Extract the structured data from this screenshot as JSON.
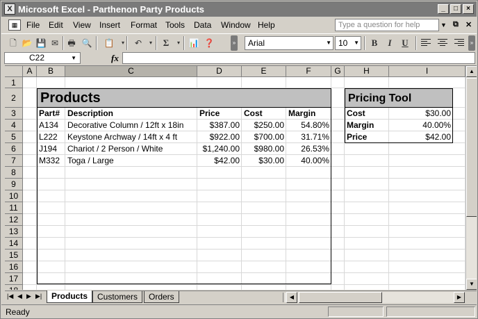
{
  "window": {
    "title": "Microsoft Excel - Parthenon Party Products",
    "app_icon": "excel-icon"
  },
  "menubar": {
    "items": [
      "File",
      "Edit",
      "View",
      "Insert",
      "Format",
      "Tools",
      "Data",
      "Window",
      "Help"
    ],
    "ask_placeholder": "Type a question for help"
  },
  "toolbar": {
    "font": "Arial",
    "font_size": "10",
    "sum_symbol": "Σ",
    "bold": "B",
    "italic": "I",
    "underline": "U"
  },
  "formulabar": {
    "name_box": "C22",
    "fx": "fx",
    "formula": ""
  },
  "sheet": {
    "columns": [
      "A",
      "B",
      "C",
      "D",
      "E",
      "F",
      "G",
      "H",
      "I"
    ],
    "active_column": "C",
    "rows": [
      "1",
      "2",
      "3",
      "4",
      "5",
      "6",
      "7",
      "8",
      "9",
      "10",
      "11",
      "12",
      "13",
      "14",
      "15",
      "16",
      "17",
      "18"
    ]
  },
  "products": {
    "title": "Products",
    "headers": [
      "Part#",
      "Description",
      "Price",
      "Cost",
      "Margin"
    ],
    "rows": [
      {
        "part": "A134",
        "description": "Decorative Column / 12ft x 18in",
        "price": "$387.00",
        "cost": "$250.00",
        "margin": "54.80%"
      },
      {
        "part": "L222",
        "description": "Keystone Archway / 14ft x 4 ft",
        "price": "$922.00",
        "cost": "$700.00",
        "margin": "31.71%"
      },
      {
        "part": "J194",
        "description": "Chariot / 2 Person / White",
        "price": "$1,240.00",
        "cost": "$980.00",
        "margin": "26.53%"
      },
      {
        "part": "M332",
        "description": "Toga / Large",
        "price": "$42.00",
        "cost": "$30.00",
        "margin": "40.00%"
      }
    ]
  },
  "pricing_tool": {
    "title": "Pricing Tool",
    "rows": [
      {
        "label": "Cost",
        "value": "$30.00"
      },
      {
        "label": "Margin",
        "value": "40.00%"
      },
      {
        "label": "Price",
        "value": "$42.00"
      }
    ]
  },
  "tabs": {
    "items": [
      "Products",
      "Customers",
      "Orders"
    ],
    "active": "Products"
  },
  "status": {
    "text": "Ready"
  }
}
